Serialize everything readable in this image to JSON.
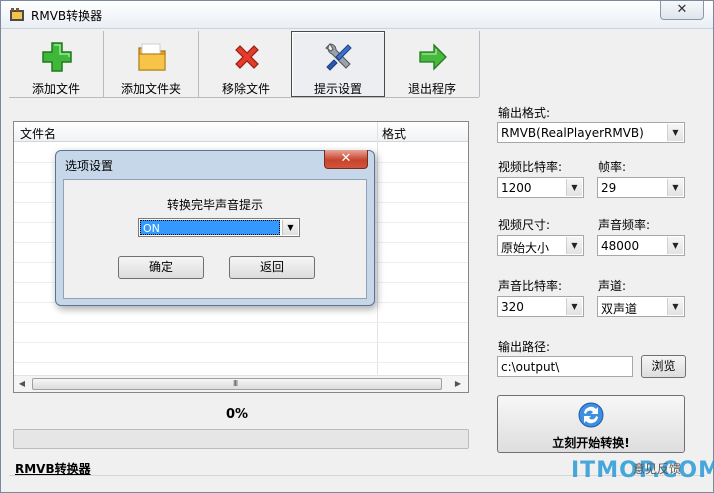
{
  "window": {
    "title": "RMVB转换器",
    "close_glyph": "✕"
  },
  "toolbar": {
    "items": [
      {
        "label": "添加文件",
        "icon": "plus-icon"
      },
      {
        "label": "添加文件夹",
        "icon": "folder-icon"
      },
      {
        "label": "移除文件",
        "icon": "remove-icon"
      },
      {
        "label": "提示设置",
        "icon": "tools-icon"
      },
      {
        "label": "退出程序",
        "icon": "exit-arrow-icon"
      }
    ]
  },
  "file_list": {
    "columns": [
      "文件名",
      "格式"
    ],
    "scroll_grip": "III"
  },
  "progress": {
    "percent_text": "0%",
    "value": 0
  },
  "brand_link": "RMVB转换器",
  "settings": {
    "output_format_label": "输出格式:",
    "output_format_value": "RMVB(RealPlayerRMVB)",
    "video_bitrate_label": "视频比特率:",
    "video_bitrate_value": "1200",
    "frame_rate_label": "帧率:",
    "frame_rate_value": "29",
    "video_size_label": "视频尺寸:",
    "video_size_value": "原始大小",
    "audio_freq_label": "声音频率:",
    "audio_freq_value": "48000",
    "audio_bitrate_label": "声音比特率:",
    "audio_bitrate_value": "320",
    "channel_label": "声道:",
    "channel_value": "双声道",
    "output_path_label": "输出路径:",
    "output_path_value": "c:\\output\\",
    "browse_label": "浏览"
  },
  "convert_button": {
    "label": "立刻开始转换!"
  },
  "feedback_label": "意见反馈",
  "watermark": "ITMOP.COM",
  "dialog": {
    "title": "选项设置",
    "close_glyph": "✕",
    "prompt": "转换完毕声音提示",
    "selected_option": "ON",
    "ok_label": "确定",
    "back_label": "返回"
  },
  "colors": {
    "progress_fill": "#06b025",
    "selection": "#3399ff",
    "watermark": "#2a9bd8"
  }
}
